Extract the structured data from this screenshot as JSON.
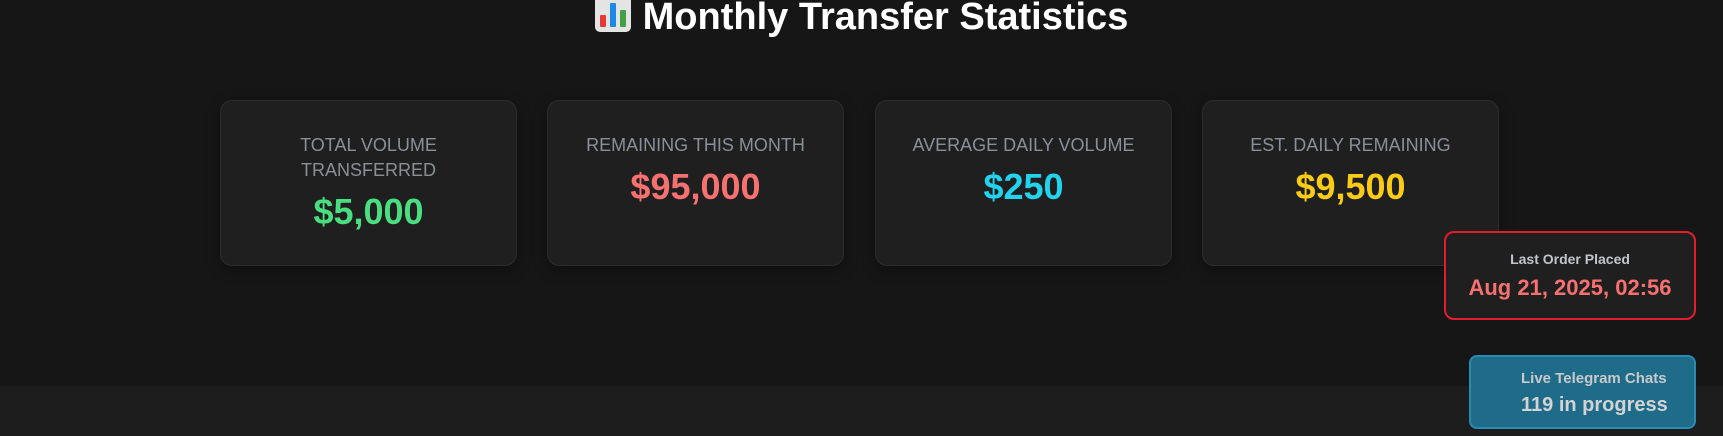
{
  "header": {
    "title": "Monthly Transfer Statistics",
    "icon": "bar-chart-icon"
  },
  "stats": [
    {
      "label": "TOTAL VOLUME TRANSFERRED",
      "value": "$5,000",
      "color": "#4ade80"
    },
    {
      "label": "REMAINING THIS MONTH",
      "value": "$95,000",
      "color": "#f87171"
    },
    {
      "label": "AVERAGE DAILY VOLUME",
      "value": "$250",
      "color": "#22d3ee"
    },
    {
      "label": "EST. DAILY REMAINING",
      "value": "$9,500",
      "color": "#facc15"
    }
  ],
  "last_order": {
    "label": "Last Order Placed",
    "value": "Aug 21, 2025, 02:56"
  },
  "live_chats": {
    "label": "Live Telegram Chats",
    "value": "119 in progress"
  },
  "colors": {
    "background": "#161616",
    "card": "#1f1f1f",
    "alert_border": "#e11d2e",
    "chat_widget": "#1e6b8a"
  }
}
